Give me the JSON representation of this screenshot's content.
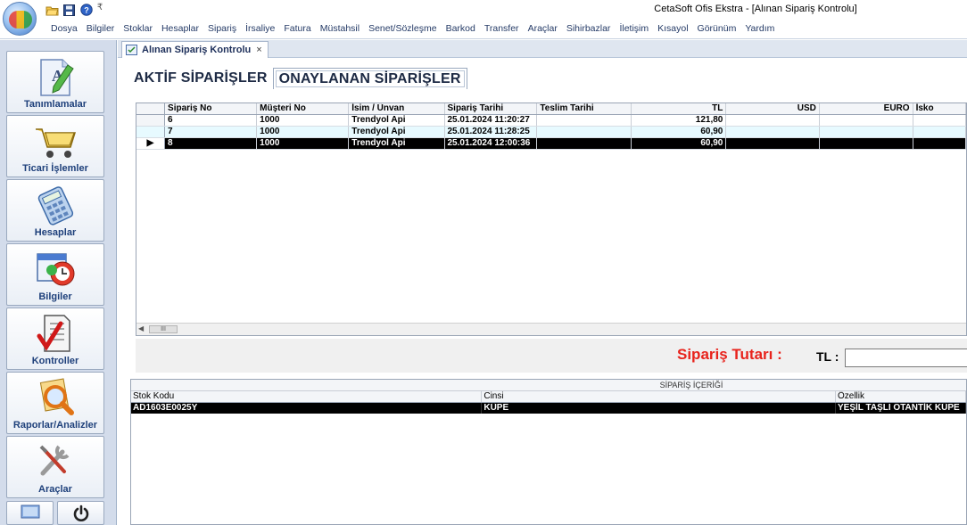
{
  "window": {
    "title": "CetaSoft Ofis Ekstra - [Alınan Sipariş Kontrolu]",
    "qat_separator": "₹"
  },
  "menu": {
    "items": [
      "Dosya",
      "Bilgiler",
      "Stoklar",
      "Hesaplar",
      "Sipariş",
      "İrsaliye",
      "Fatura",
      "Müstahsil",
      "Senet/Sözleşme",
      "Barkod",
      "Transfer",
      "Araçlar",
      "Sihirbazlar",
      "İletişim",
      "Kısayol",
      "Görünüm",
      "Yardım"
    ]
  },
  "sidebar": {
    "items": [
      {
        "label": "Tanımlamalar",
        "icon": "document-pencil-icon"
      },
      {
        "label": "Ticari İşlemler",
        "icon": "shopping-cart-icon"
      },
      {
        "label": "Hesaplar",
        "icon": "calculator-icon"
      },
      {
        "label": "Bilgiler",
        "icon": "calendar-clock-icon"
      },
      {
        "label": "Kontroller",
        "icon": "checklist-icon"
      },
      {
        "label": "Raporlar/Analizler",
        "icon": "magnifier-report-icon"
      },
      {
        "label": "Araçlar",
        "icon": "tools-icon"
      }
    ],
    "bottom": [
      {
        "icon": "desktop-icon"
      },
      {
        "icon": "power-icon"
      }
    ]
  },
  "doc_tab": {
    "label": "Alınan Sipariş Kontrolu",
    "close": "×"
  },
  "subtabs": [
    "AKTİF SİPARİŞLER",
    "ONAYLANAN SİPARİŞLER"
  ],
  "orders": {
    "columns": [
      "Sipariş No",
      "Müşteri No",
      "İsim / Ünvan",
      "Sipariş Tarihi",
      "Teslim Tarihi",
      "TL",
      "USD",
      "EURO",
      "İsko"
    ],
    "rows": [
      [
        "6",
        "1000",
        "Trendyol Api",
        "25.01.2024 11:20:27",
        "",
        "121,80",
        "",
        "",
        ""
      ],
      [
        "7",
        "1000",
        "Trendyol Api",
        "25.01.2024 11:28:25",
        "",
        "60,90",
        "",
        "",
        ""
      ],
      [
        "8",
        "1000",
        "Trendyol Api",
        "25.01.2024 12:00:36",
        "",
        "60,90",
        "",
        "",
        ""
      ]
    ],
    "selected_row_marker": "▶",
    "scroll_thumb": "III"
  },
  "totals": {
    "label": "Sipariş Tutarı :",
    "tl_label": "TL :",
    "tl_value": ""
  },
  "contents": {
    "title": "SİPARİŞ İÇERİĞİ",
    "columns": [
      "Stok Kodu",
      "Cinsi",
      "Özellik"
    ],
    "rows": [
      [
        "AD1603E0025Y",
        "KÜPE",
        "YEŞİL TAŞLI OTANTİK KÜPE"
      ]
    ]
  },
  "colors": {
    "accent_red": "#e8231c",
    "selection": "#000000",
    "alt_row": "#e7faff",
    "menu_text": "#243a66"
  }
}
